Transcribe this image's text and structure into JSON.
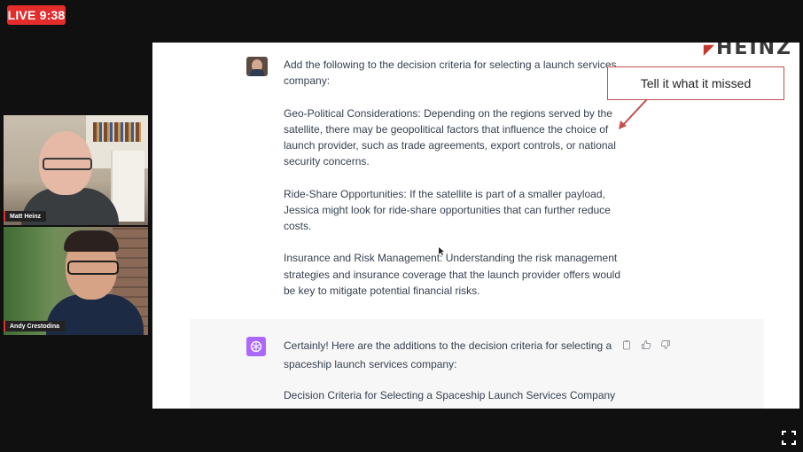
{
  "stream": {
    "live_label": "LIVE 9:38"
  },
  "participants": [
    {
      "name": "Matt Heinz"
    },
    {
      "name": "Andy Crestodina"
    }
  ],
  "brand": {
    "logo_text": "HEINZ"
  },
  "callout": {
    "text": "Tell it what it missed"
  },
  "user_message": {
    "paragraphs": [
      "Add the following to the decision criteria for selecting a launch services company:",
      "Geo-Political Considerations: Depending on the regions served by the satellite, there may be geopolitical factors that influence the choice of launch provider, such as trade agreements, export controls, or national security concerns.",
      "Ride-Share Opportunities: If the satellite is part of a smaller payload, Jessica might look for ride-share opportunities that can further reduce costs.",
      "Insurance and Risk Management: Understanding the risk management strategies and insurance coverage that the launch provider offers would be key to mitigate potential financial risks."
    ]
  },
  "assistant_message": {
    "paragraphs": [
      "Certainly! Here are the additions to the decision criteria for selecting a spaceship launch services company:",
      "Decision Criteria for Selecting a Spaceship Launch Services Company"
    ]
  },
  "icons": {
    "copy": "clipboard-icon",
    "thumbs_up": "thumbs-up-icon",
    "thumbs_down": "thumbs-down-icon",
    "fullscreen": "fullscreen-icon"
  },
  "colors": {
    "live_red": "#e32d2d",
    "callout_border": "#c0504d",
    "assistant_avatar": "#ab68ff",
    "assistant_bg": "#f7f7f8"
  }
}
